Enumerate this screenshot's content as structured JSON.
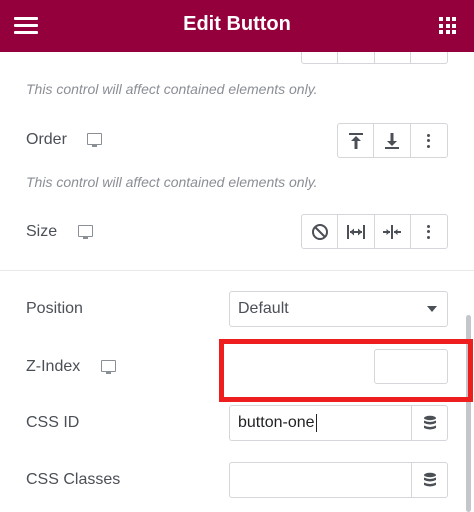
{
  "header": {
    "title": "Edit Button",
    "background_color": "#93003c",
    "menu_icon": "hamburger-icon",
    "apps_icon": "grid-icon"
  },
  "controls": {
    "partial_hint": "This control will affect contained elements only.",
    "order": {
      "label": "Order",
      "device_icon": "desktop-icon",
      "hint": "This control will affect contained elements only.",
      "options": [
        "align-start-icon",
        "align-end-icon",
        "more-icon"
      ]
    },
    "size": {
      "label": "Size",
      "device_icon": "desktop-icon",
      "options": [
        "none-icon",
        "grow-icon",
        "shrink-icon",
        "more-icon"
      ]
    },
    "position": {
      "label": "Position",
      "value": "Default"
    },
    "z_index": {
      "label": "Z-Index",
      "device_icon": "desktop-icon",
      "value": ""
    },
    "css_id": {
      "label": "CSS ID",
      "value": "button-one",
      "dynamic_icon": "database-icon"
    },
    "css_classes": {
      "label": "CSS Classes",
      "value": "",
      "dynamic_icon": "database-icon"
    }
  },
  "highlight_color": "#ee1e1e"
}
